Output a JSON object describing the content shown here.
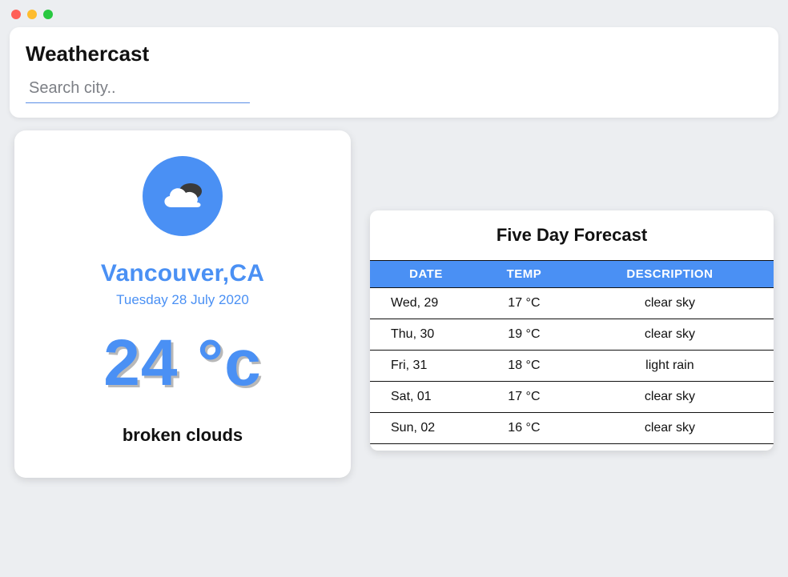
{
  "header": {
    "title": "Weathercast",
    "search_placeholder": "Search city.."
  },
  "current": {
    "location": "Vancouver,CA",
    "date": "Tuesday 28 July 2020",
    "temp": "24 °c",
    "condition": "broken clouds",
    "icon": "cloud-icon"
  },
  "forecast": {
    "title": "Five Day Forecast",
    "columns": {
      "date": "DATE",
      "temp": "TEMP",
      "desc": "DESCRIPTION"
    },
    "rows": [
      {
        "date": "Wed, 29",
        "temp": "17 °C",
        "desc": "clear sky"
      },
      {
        "date": "Thu, 30",
        "temp": "19 °C",
        "desc": "clear sky"
      },
      {
        "date": "Fri, 31",
        "temp": "18 °C",
        "desc": "light rain"
      },
      {
        "date": "Sat, 01",
        "temp": "17 °C",
        "desc": "clear sky"
      },
      {
        "date": "Sun, 02",
        "temp": "16 °C",
        "desc": "clear sky"
      }
    ]
  },
  "colors": {
    "accent": "#4a90f4"
  }
}
